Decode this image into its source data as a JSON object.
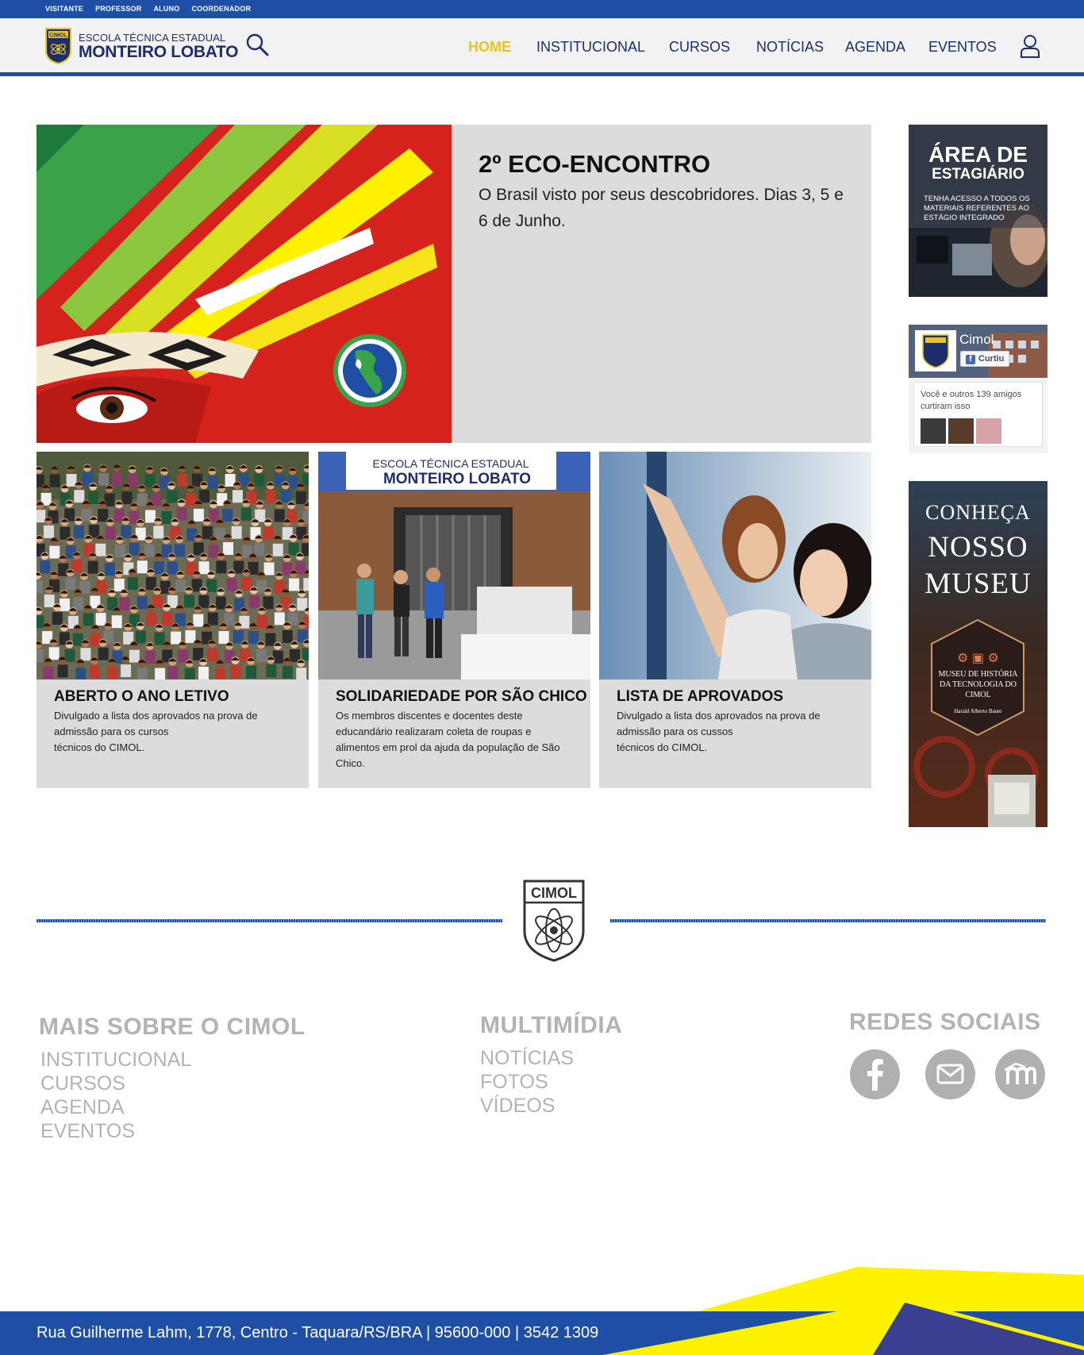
{
  "topbar": {
    "links": [
      "VISITANTE",
      "PROFESSOR",
      "ALUNO",
      "COORDENADOR"
    ]
  },
  "header": {
    "logo_badge": "CIMOL",
    "logo_line1": "ESCOLA TÉCNICA ESTADUAL",
    "logo_line2": "MONTEIRO LOBATO",
    "nav": [
      "HOME",
      "INSTITUCIONAL",
      "CURSOS",
      "NOTÍCIAS",
      "AGENDA",
      "EVENTOS"
    ],
    "active_nav": "HOME",
    "icons": [
      "search-icon",
      "user-icon"
    ]
  },
  "hero": {
    "title": "2º ECO-ENCONTRO",
    "description": "O Brasil visto por seus descobridores. Dias 3, 5 e 6 de Junho."
  },
  "cards": [
    {
      "title": "ABERTO O ANO LETIVO",
      "description": "Divulgado a lista dos aprovados na prova de\nadmissão para os cursos\ntécnicos do CIMOL."
    },
    {
      "title": "SOLIDARIEDADE POR SÃO CHICO",
      "description": "Os membros discentes e docentes deste educandário realizaram coleta de roupas e alimentos em prol da ajuda da população de São Chico.",
      "banner_line1": "ESCOLA TÉCNICA ESTADUAL",
      "banner_line2": "MONTEIRO LOBATO"
    },
    {
      "title": "LISTA DE APROVADOS",
      "description": "Divulgado a lista dos aprovados na prova de\nadmissão para os cussos\ntécnicos do CIMOL."
    }
  ],
  "sidebar": {
    "estagio": {
      "title1": "ÁREA DE",
      "title2": "ESTAGIÁRIO",
      "text": "TENHA ACESSO A TODOS OS MATERIAIS REFERENTES AO ESTÁGIO INTEGRADO"
    },
    "facebook": {
      "page_name": "Cimol",
      "like_button": "Curtiu",
      "friends_text": "Você e outros 139 amigos curtiram isso"
    },
    "museu": {
      "line1": "CONHEÇA",
      "line2": "NOSSO",
      "line3": "MUSEU",
      "badge_text": "MUSEU DE HISTÓRIA DA TECNOLOGIA DO CIMOL",
      "badge_author": "Harald Alberto Bauer"
    }
  },
  "footer": {
    "crest_label": "CIMOL",
    "col1": {
      "heading": "MAIS SOBRE O CIMOL",
      "links": [
        "INSTITUCIONAL",
        "CURSOS",
        "AGENDA",
        "EVENTOS"
      ]
    },
    "col2": {
      "heading": "MULTIMÍDIA",
      "links": [
        "NOTÍCIAS",
        "FOTOS",
        "VÍDEOS"
      ]
    },
    "col3": {
      "heading": "REDES SOCIAIS",
      "icons": [
        "facebook-icon",
        "mail-icon",
        "moodle-icon"
      ]
    },
    "address": "Rua Guilherme Lahm, 1778, Centro - Taquara/RS/BRA | 95600-000 | 3542 1309"
  },
  "colors": {
    "brand_blue": "#1f4fa5",
    "navy": "#1d2e6b",
    "active_nav": "#e8c51a",
    "panel_gray": "#dcdcdc",
    "footer_gray": "#b3b3b3",
    "yellow": "#fff200"
  }
}
